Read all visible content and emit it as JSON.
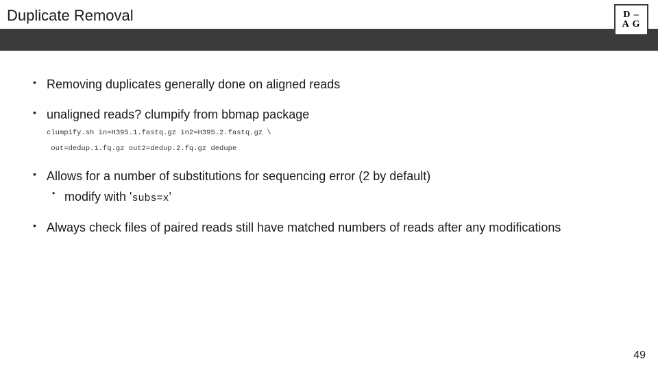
{
  "header": {
    "title": "Duplicate Removal",
    "logo": {
      "top": "D –",
      "bottom": "A G"
    }
  },
  "body": {
    "bullets": [
      {
        "text": "Removing duplicates generally done on aligned reads"
      },
      {
        "text": "unaligned reads? clumpify from bbmap package",
        "code": [
          "clumpify.sh in=H395.1.fastq.gz in2=H395.2.fastq.gz \\",
          " out=dedup.1.fq.gz out2=dedup.2.fq.gz dedupe"
        ]
      },
      {
        "text": "Allows for a number of substitutions for sequencing error (2 by default)",
        "sub": [
          {
            "prefix": "modify with '",
            "code": "subs=x",
            "suffix": "'"
          }
        ]
      },
      {
        "text": "Always check files of paired reads still have matched numbers of reads after any modifications"
      }
    ]
  },
  "footer": {
    "page": "49"
  }
}
